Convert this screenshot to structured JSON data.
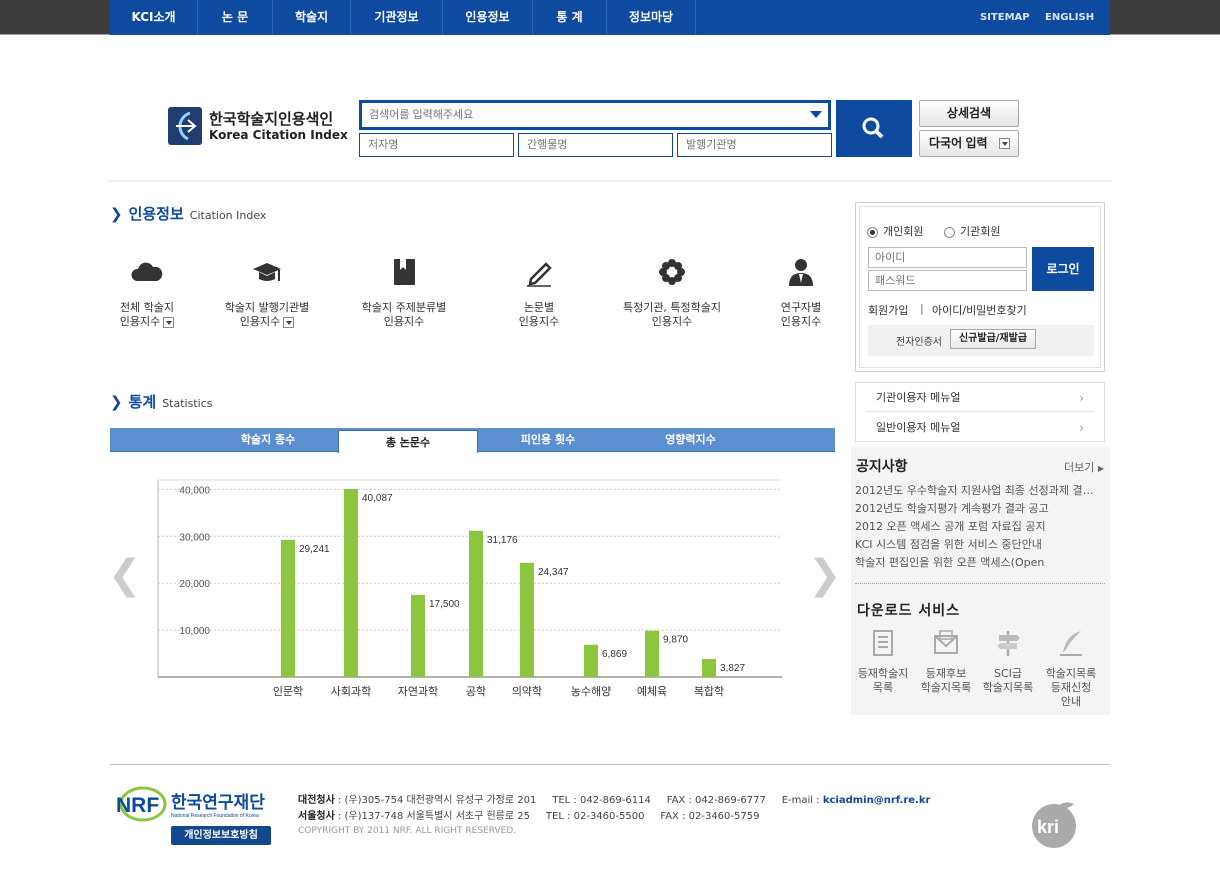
{
  "nav": {
    "items": [
      "KCI소개",
      "논 문",
      "학술지",
      "기관정보",
      "인용정보",
      "통 계",
      "정보마당"
    ],
    "sitemap": "SITEMAP",
    "english": "ENGLISH"
  },
  "logo": {
    "ko": "한국학술지인용색인",
    "en": "Korea Citation Index"
  },
  "search": {
    "main_placeholder": "검색어를 입력해주세요",
    "author_placeholder": "저자명",
    "journal_placeholder": "간행물명",
    "publisher_placeholder": "발행기관명",
    "advanced_label": "상세검색",
    "multilang_label": "다국어 입력"
  },
  "citation": {
    "title": "인용정보",
    "subtitle": "Citation Index",
    "items": [
      {
        "line1": "전체 학술지",
        "line2": "인용지수",
        "icon": "cloud-icon"
      },
      {
        "line1": "학술지 발행기관별",
        "line2": "인용지수",
        "icon": "graduation-cap-icon"
      },
      {
        "line1": "학술지 주제분류별",
        "line2": "인용지수",
        "icon": "book-icon"
      },
      {
        "line1": "논문별",
        "line2": "인용지수",
        "icon": "pen-icon"
      },
      {
        "line1": "특정기관, 특정학술지",
        "line2": "인용지수",
        "icon": "flower-icon"
      },
      {
        "line1": "연구자별",
        "line2": "인용지수",
        "icon": "person-icon"
      }
    ]
  },
  "stats": {
    "title": "통계",
    "subtitle": "Statistics",
    "tabs": [
      "학술지 종수",
      "총 논문수",
      "피인용 횟수",
      "영향력지수"
    ],
    "active_tab": "총 논문수"
  },
  "chart_data": {
    "type": "bar",
    "categories": [
      "인문학",
      "사회과학",
      "자연과학",
      "공학",
      "의약학",
      "농수해양",
      "예체육",
      "복합학"
    ],
    "values": [
      29241,
      40087,
      17500,
      31176,
      24347,
      6869,
      9870,
      3827
    ],
    "value_labels": [
      "29,241",
      "40,087",
      "17,500",
      "31,176",
      "24,347",
      "6,869",
      "9,870",
      "3,827"
    ],
    "yticks": [
      "10,000",
      "20,000",
      "30,000",
      "40,000"
    ],
    "ylim": [
      0,
      42000
    ],
    "grid": true,
    "bar_color": "#8cc63f"
  },
  "login": {
    "personal": "개인회원",
    "institution": "기관회원",
    "id_placeholder": "아이디",
    "pw_placeholder": "패스워드",
    "login_btn": "로그인",
    "join": "회원가입",
    "sep": "|",
    "find": "아이디/비밀번호찾기",
    "cert_label": "전자인증서",
    "cert_btn": "신규발급/재발급"
  },
  "manuals": [
    "기관이용자 메뉴얼",
    "일반이용자 메뉴얼"
  ],
  "notice": {
    "title": "공지사항",
    "more": "더보기",
    "items": [
      "2012년도 우수학술지 지원사업 최종 선정과제 결과 공고",
      "2012년도 학술지평가 계속평가 결과 공고",
      "2012 오픈 액세스 공개 포럼 자료집 공지",
      "KCI 시스템 점검을 위한 서비스 중단안내",
      "학술지 편집인을 위한 오픈 액세스(Open"
    ]
  },
  "download": {
    "title": "다운로드 서비스",
    "items": [
      {
        "l1": "등재학술지",
        "l2": "목록",
        "l3": ""
      },
      {
        "l1": "등재후보",
        "l2": "학술지목록",
        "l3": ""
      },
      {
        "l1": "SCI급",
        "l2": "학술지목록",
        "l3": ""
      },
      {
        "l1": "학술지목록",
        "l2": "등재신청",
        "l3": "안내"
      }
    ]
  },
  "footer": {
    "nrf_ko": "한국연구재단",
    "nrf_en": "National Research Foundation of Korea",
    "privacy": "개인정보보호방침",
    "line1_label": "대전청사",
    "line1": ": (우)305-754 대전광역시 유성구 가정로 201",
    "line1_tel": "TEL : 042-869-6114",
    "line1_fax": "FAX : 042-869-6777",
    "email_label": "E-mail :",
    "email": "kciadmin@nrf.re.kr",
    "line2_label": "서울청사",
    "line2": ": (우)137-748 서울특별시 서초구 헌릉로 25",
    "line2_tel": "TEL : 02-3460-5500",
    "line2_fax": "FAX : 02-3460-5759",
    "copyright": "COPYRIGHT BY 2011 NRF. ALL RIGHT RESERVED.",
    "kri": "kri"
  }
}
